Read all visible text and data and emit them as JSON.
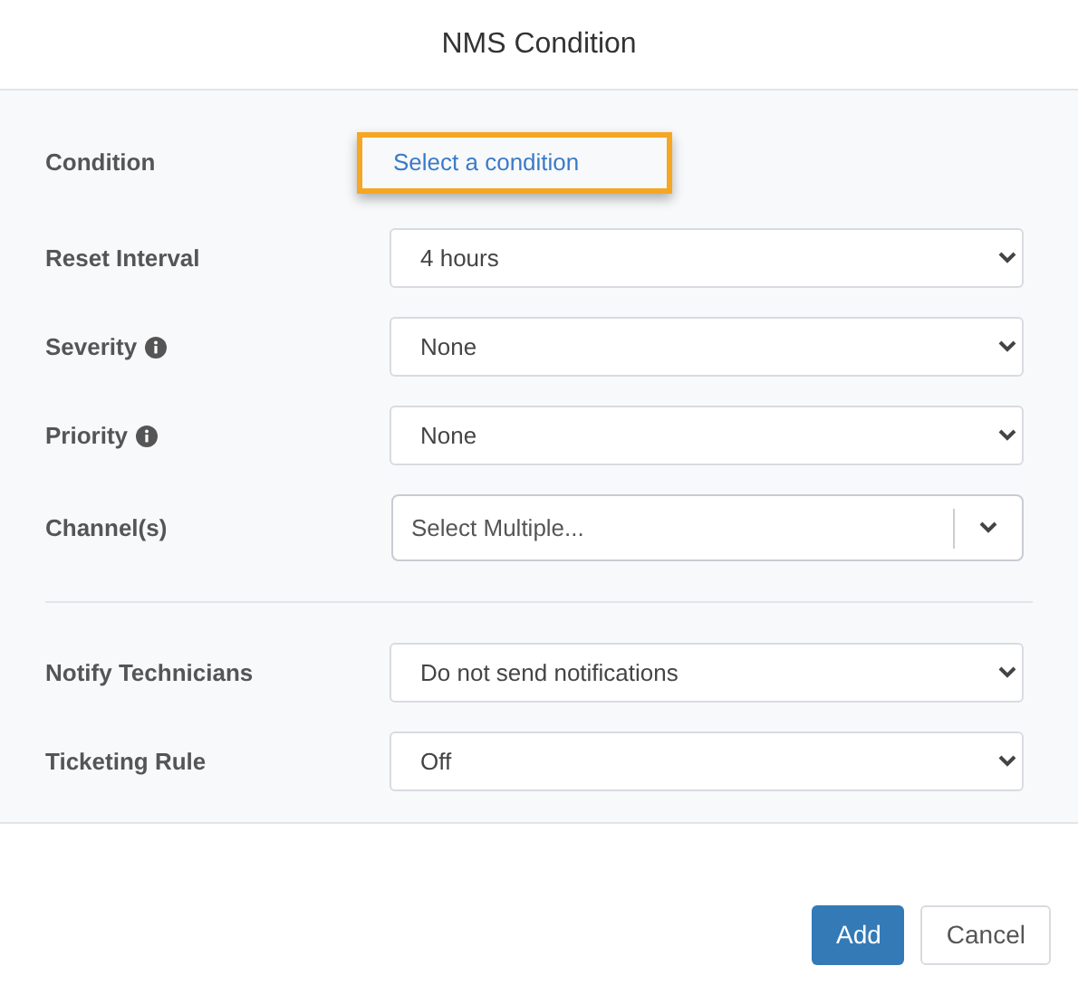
{
  "dialog": {
    "title": "NMS Condition"
  },
  "sections": [
    [
      {
        "label": "Condition",
        "info": false,
        "kind": "link",
        "value": "Select a condition",
        "highlighted": true
      },
      {
        "label": "Reset Interval",
        "info": false,
        "kind": "select",
        "value": "4 hours"
      },
      {
        "label": "Severity",
        "info": true,
        "kind": "select",
        "value": "None"
      },
      {
        "label": "Priority",
        "info": true,
        "kind": "select",
        "value": "None"
      },
      {
        "label": "Channel(s)",
        "info": false,
        "kind": "multiselect",
        "placeholder": "Select Multiple..."
      }
    ],
    [
      {
        "label": "Notify Technicians",
        "info": false,
        "kind": "select",
        "value": "Do not send notifications"
      },
      {
        "label": "Ticketing Rule",
        "info": false,
        "kind": "select",
        "value": "Off"
      }
    ]
  ],
  "buttons": [
    {
      "label": "Add",
      "kind": "primary"
    },
    {
      "label": "Cancel",
      "kind": "secondary"
    }
  ]
}
